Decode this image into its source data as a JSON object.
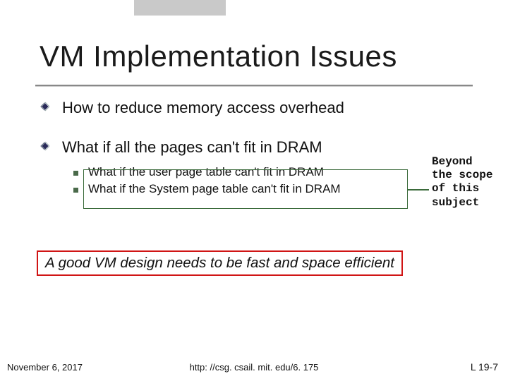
{
  "title": "VM Implementation Issues",
  "bullets": {
    "b1": "How to reduce memory access overhead",
    "b2": "What if all the pages can't fit in DRAM",
    "b2_sub1": "What if the user page table can't fit in DRAM",
    "b2_sub2": "What if the System page table can't fit in DRAM"
  },
  "callout": "Beyond\nthe scope\nof this\nsubject",
  "emphasis": "A good VM design needs to be fast and space efficient",
  "footer": {
    "date": "November 6, 2017",
    "url": "http: //csg. csail. mit. edu/6. 175",
    "page": "L 19-7"
  }
}
